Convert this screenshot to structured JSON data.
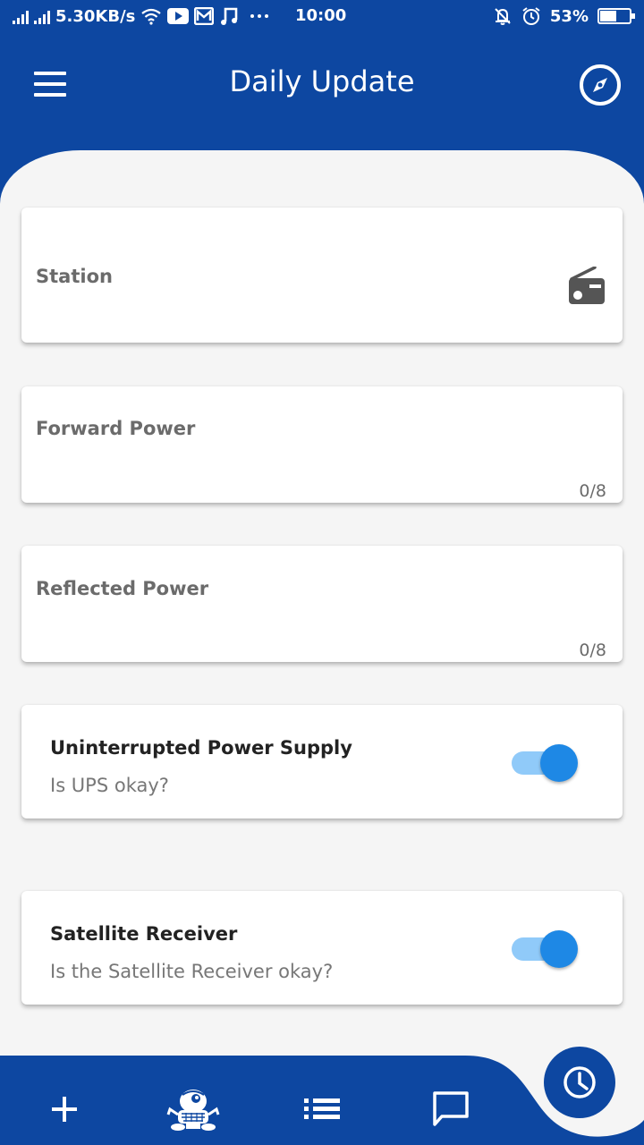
{
  "status_bar": {
    "net_speed": "5.30KB/s",
    "time": "10:00",
    "battery": "53%",
    "battery_level": 0.53,
    "icons": [
      "signal-icon",
      "signal-icon",
      "wifi-icon",
      "youtube-icon",
      "mail-icon",
      "music-icon",
      "more-dots-icon",
      "alarm-off-icon",
      "alarm-icon",
      "battery-icon"
    ]
  },
  "app_bar": {
    "title": "Daily Update",
    "left_icon": "menu-icon",
    "right_icon": "compass-icon"
  },
  "form": {
    "station": {
      "label": "Station",
      "icon": "radio-icon"
    },
    "forward_power": {
      "label": "Forward Power",
      "counter": "0/8"
    },
    "reflected_power": {
      "label": "Reflected Power",
      "counter": "0/8"
    },
    "ups": {
      "title": "Uninterrupted Power Supply",
      "subtitle": "Is UPS okay?",
      "checked": true
    },
    "satellite": {
      "title": "Satellite Receiver",
      "subtitle": "Is the Satellite Receiver okay?",
      "checked": true
    }
  },
  "bottom_nav": {
    "items": [
      "add-icon",
      "mascot-icon",
      "list-icon",
      "chat-icon"
    ],
    "fab_icon": "clock-icon"
  },
  "colors": {
    "primary": "#0d47a1",
    "switch_thumb": "#1e88e5",
    "switch_track": "#90caf9",
    "background": "#f5f5f5"
  }
}
